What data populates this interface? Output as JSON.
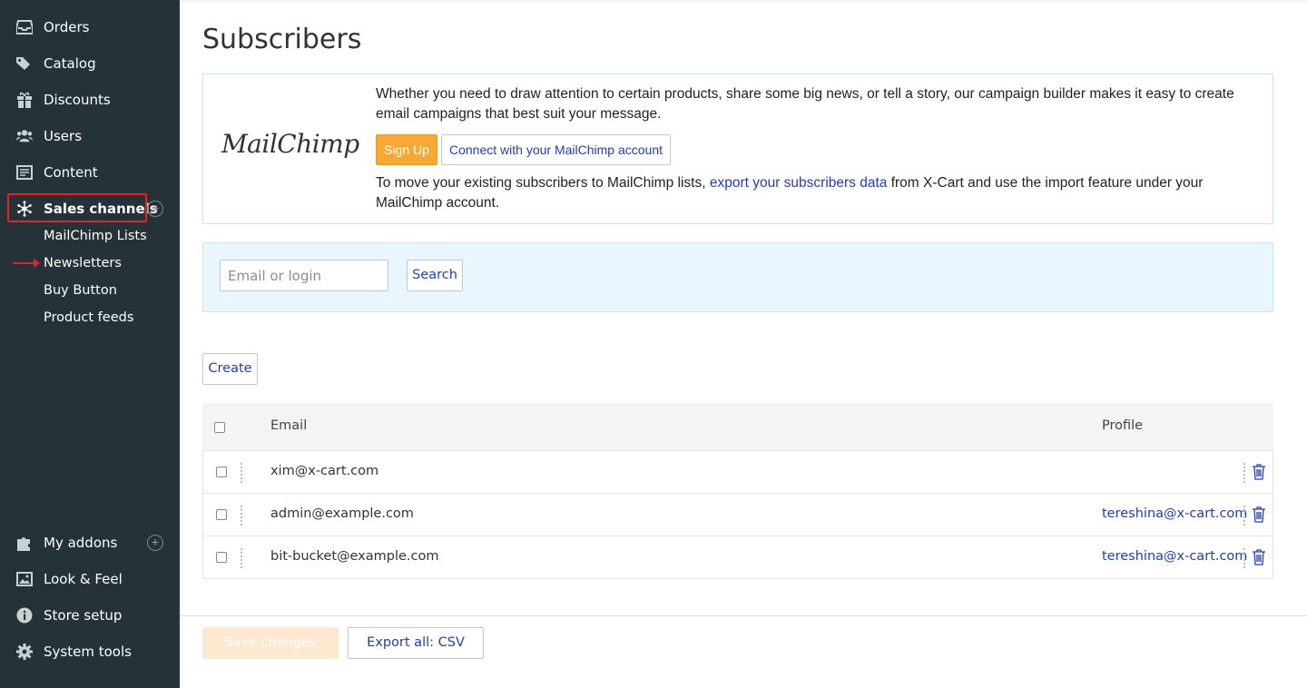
{
  "sidebar": {
    "items": [
      {
        "label": "Orders",
        "icon": "inbox-icon"
      },
      {
        "label": "Catalog",
        "icon": "tags-icon"
      },
      {
        "label": "Discounts",
        "icon": "gift-icon"
      },
      {
        "label": "Users",
        "icon": "users-icon"
      },
      {
        "label": "Content",
        "icon": "content-icon"
      },
      {
        "label": "Sales channels",
        "icon": "network-icon",
        "active": true
      }
    ],
    "sub_items": [
      "MailChimp Lists",
      "Newsletters",
      "Buy Button",
      "Product feeds"
    ],
    "bottom_items": [
      {
        "label": "My addons",
        "icon": "puzzle-icon"
      },
      {
        "label": "Look & Feel",
        "icon": "image-icon"
      },
      {
        "label": "Store setup",
        "icon": "info-icon"
      },
      {
        "label": "System tools",
        "icon": "gear-icon"
      }
    ],
    "plus": "+"
  },
  "page": {
    "title": "Subscribers"
  },
  "mailchimp": {
    "logo_text": "MailChimp",
    "intro": "Whether you need to draw attention to certain products, share some big news, or tell a story, our campaign builder makes it easy to create email campaigns that best suit your message.",
    "signup_label": "Sign Up",
    "connect_label": "Connect with your MailChimp account",
    "move_prefix": "To move your existing subscribers to MailChimp lists, ",
    "move_link": "export your subscribers data",
    "move_suffix": " from X-Cart and use the import feature under your MailChimp account."
  },
  "search": {
    "placeholder": "Email or login",
    "button_label": "Search"
  },
  "create_label": "Create",
  "table": {
    "columns": [
      "Email",
      "Profile"
    ],
    "rows": [
      {
        "email": "xim@x-cart.com",
        "profile": ""
      },
      {
        "email": "admin@example.com",
        "profile": "tereshina@x-cart.com"
      },
      {
        "email": "bit-bucket@example.com",
        "profile": "tereshina@x-cart.com"
      }
    ]
  },
  "footer": {
    "save_label": "Save changes",
    "export_label": "Export all: CSV"
  },
  "colors": {
    "sidebar_bg": "#253338",
    "accent": "#f7a935",
    "link": "#2540a3",
    "highlight": "#e3232b"
  }
}
